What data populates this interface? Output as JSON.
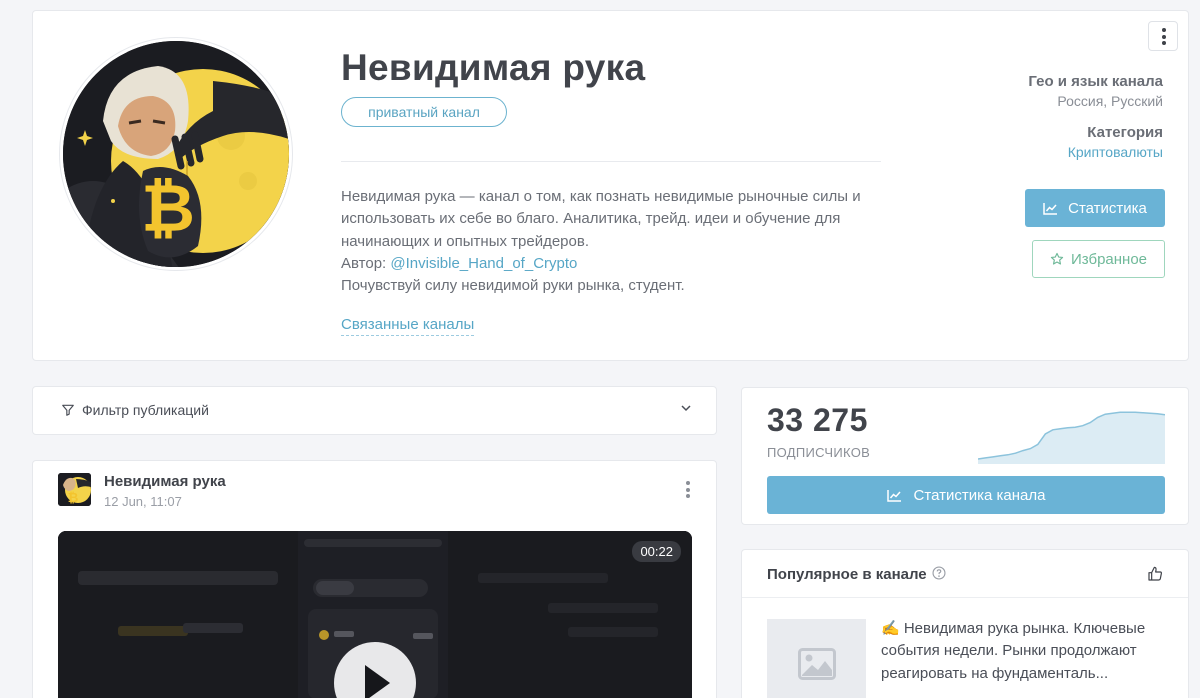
{
  "header": {
    "title": "Невидимая рука",
    "badge": "приватный канал",
    "description_lines": [
      "Невидимая рука — канал о том, как познать невидимые рыночные силы и",
      "использовать их себе во благо. Аналитика, трейд. идеи и обучение для",
      "начинающих и опытных трейдеров."
    ],
    "author_prefix": "Автор: ",
    "author_link": "@Invisible_Hand_of_Crypto",
    "tagline": "Почувствуй силу невидимой руки рынка, студент.",
    "related_link": "Связанные каналы",
    "geo_label": "Гео и язык канала",
    "geo_value": "Россия, Русский",
    "category_label": "Категория",
    "category_value": "Криптовалюты",
    "stats_button": "Статистика",
    "favorite_button": "Избранное",
    "menu_icon": "more-vertical-icon"
  },
  "filter": {
    "label": "Фильтр публикаций"
  },
  "post": {
    "author": "Невидимая рука",
    "date": "12 Jun, 11:07",
    "duration": "00:22"
  },
  "subscribers": {
    "count": "33 275",
    "label": "ПОДПИСЧИКОВ",
    "button": "Статистика канала",
    "trend": [
      0.02,
      0.04,
      0.06,
      0.08,
      0.1,
      0.13,
      0.18,
      0.22,
      0.3,
      0.5,
      0.58,
      0.6,
      0.62,
      0.63,
      0.66,
      0.72,
      0.82,
      0.88,
      0.9,
      0.92,
      0.92,
      0.92,
      0.91,
      0.9,
      0.89,
      0.87
    ]
  },
  "popular": {
    "title": "Популярное в канале",
    "text_lines": [
      "✍️ Невидимая рука рынка. Ключевые",
      "события недели. Рынки продолжают",
      "реагировать на фундаменталь..."
    ]
  },
  "colors": {
    "accent": "#6ab3d6",
    "link": "#56a6c6",
    "favorite": "#6fb999"
  }
}
